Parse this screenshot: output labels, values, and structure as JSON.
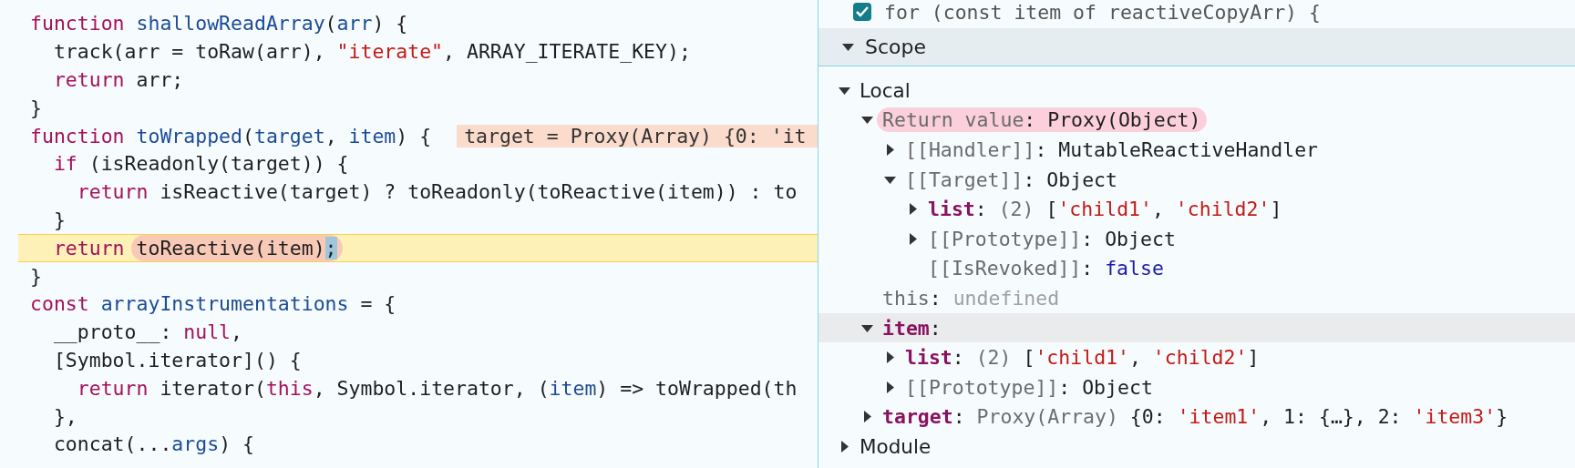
{
  "code": {
    "lines": [
      {
        "current": false,
        "tokens": [
          {
            "kind": "keyword",
            "text": "function "
          },
          {
            "kind": "name",
            "text": "shallowReadArray"
          },
          {
            "kind": "plain",
            "text": "("
          },
          {
            "kind": "name",
            "text": "arr"
          },
          {
            "kind": "plain",
            "text": ") {"
          }
        ]
      },
      {
        "current": false,
        "tokens": [
          {
            "kind": "plain",
            "text": "  track(arr = toRaw(arr), "
          },
          {
            "kind": "string",
            "text": "\"iterate\""
          },
          {
            "kind": "plain",
            "text": ", ARRAY_ITERATE_KEY);"
          }
        ]
      },
      {
        "current": false,
        "tokens": [
          {
            "kind": "keyword",
            "text": "  return"
          },
          {
            "kind": "plain",
            "text": " arr;"
          }
        ]
      },
      {
        "current": false,
        "tokens": [
          {
            "kind": "plain",
            "text": "}"
          }
        ]
      },
      {
        "current": false,
        "inline_value": "target = Proxy(Array) {0: 'it",
        "tokens": [
          {
            "kind": "keyword",
            "text": "function "
          },
          {
            "kind": "name",
            "text": "toWrapped"
          },
          {
            "kind": "plain",
            "text": "("
          },
          {
            "kind": "name",
            "text": "target"
          },
          {
            "kind": "plain",
            "text": ", "
          },
          {
            "kind": "name",
            "text": "item"
          },
          {
            "kind": "plain",
            "text": ") {"
          }
        ]
      },
      {
        "current": false,
        "tokens": [
          {
            "kind": "keyword",
            "text": "  if"
          },
          {
            "kind": "plain",
            "text": " (isReadonly(target)) {"
          }
        ]
      },
      {
        "current": false,
        "tokens": [
          {
            "kind": "keyword",
            "text": "    return"
          },
          {
            "kind": "plain",
            "text": " isReactive(target) ? toReadonly(toReactive(item)) : to"
          }
        ]
      },
      {
        "current": false,
        "tokens": [
          {
            "kind": "plain",
            "text": "  }"
          }
        ]
      },
      {
        "current": true,
        "tokens": [
          {
            "kind": "keyword",
            "text": "  return "
          },
          {
            "kind": "circled",
            "tokens": [
              {
                "kind": "plain",
                "text": "toReactive(item)"
              },
              {
                "kind": "selection",
                "text": ";"
              }
            ]
          }
        ]
      },
      {
        "current": false,
        "tokens": [
          {
            "kind": "plain",
            "text": "}"
          }
        ]
      },
      {
        "current": false,
        "tokens": [
          {
            "kind": "keyword",
            "text": "const "
          },
          {
            "kind": "name",
            "text": "arrayInstrumentations"
          },
          {
            "kind": "plain",
            "text": " = {"
          }
        ]
      },
      {
        "current": false,
        "tokens": [
          {
            "kind": "plain",
            "text": "  __proto__: "
          },
          {
            "kind": "keyword",
            "text": "null"
          },
          {
            "kind": "plain",
            "text": ","
          }
        ]
      },
      {
        "current": false,
        "tokens": [
          {
            "kind": "plain",
            "text": "  [Symbol.iterator]() {"
          }
        ]
      },
      {
        "current": false,
        "tokens": [
          {
            "kind": "keyword",
            "text": "    return"
          },
          {
            "kind": "plain",
            "text": " iterator("
          },
          {
            "kind": "keyword",
            "text": "this"
          },
          {
            "kind": "plain",
            "text": ", Symbol.iterator, ("
          },
          {
            "kind": "name",
            "text": "item"
          },
          {
            "kind": "plain",
            "text": ") => toWrapped(th"
          }
        ]
      },
      {
        "current": false,
        "tokens": [
          {
            "kind": "plain",
            "text": "  },"
          }
        ]
      },
      {
        "current": false,
        "tokens": [
          {
            "kind": "plain",
            "text": "  concat(..."
          },
          {
            "kind": "name",
            "text": "args"
          },
          {
            "kind": "plain",
            "text": ") {"
          }
        ]
      }
    ]
  },
  "breakpoint": {
    "checked": true,
    "code": "for (const item of reactiveCopyArr) {"
  },
  "scope": {
    "title": "Scope",
    "expanded": true,
    "tree": [
      {
        "key": "Local",
        "kind": "name",
        "expanded": true,
        "selected": false,
        "highlighted": false,
        "children": [
          {
            "key": "Return value",
            "kind": "internal",
            "expanded": true,
            "selected": false,
            "highlighted": true,
            "value": [
              {
                "kind": "plain",
                "text": ": Proxy(Object)"
              }
            ],
            "children": [
              {
                "key": "[[Handler]]",
                "kind": "internal",
                "expanded": false,
                "selected": false,
                "highlighted": false,
                "value": [
                  {
                    "kind": "plain",
                    "text": ": MutableReactiveHandler"
                  }
                ]
              },
              {
                "key": "[[Target]]",
                "kind": "internal",
                "expanded": true,
                "selected": false,
                "highlighted": false,
                "value": [
                  {
                    "kind": "plain",
                    "text": ": Object"
                  }
                ],
                "children": [
                  {
                    "key": "list",
                    "kind": "property",
                    "expanded": false,
                    "selected": false,
                    "highlighted": false,
                    "value": [
                      {
                        "kind": "plain",
                        "text": ": "
                      },
                      {
                        "kind": "muted",
                        "text": "(2) "
                      },
                      {
                        "kind": "plain",
                        "text": "["
                      },
                      {
                        "kind": "string",
                        "text": "'child1'"
                      },
                      {
                        "kind": "plain",
                        "text": ", "
                      },
                      {
                        "kind": "string",
                        "text": "'child2'"
                      },
                      {
                        "kind": "plain",
                        "text": "]"
                      }
                    ]
                  },
                  {
                    "key": "[[Prototype]]",
                    "kind": "internal",
                    "expanded": false,
                    "selected": false,
                    "highlighted": false,
                    "value": [
                      {
                        "kind": "plain",
                        "text": ": Object"
                      }
                    ]
                  },
                  {
                    "key": "[[IsRevoked]]",
                    "kind": "internal",
                    "selected": false,
                    "highlighted": false,
                    "value": [
                      {
                        "kind": "plain",
                        "text": ": "
                      },
                      {
                        "kind": "literal",
                        "text": "false"
                      }
                    ]
                  }
                ]
              }
            ]
          },
          {
            "key": "this",
            "kind": "internal",
            "selected": false,
            "highlighted": false,
            "value": [
              {
                "kind": "plain",
                "text": ": "
              },
              {
                "kind": "faint",
                "text": "undefined"
              }
            ]
          },
          {
            "key": "item",
            "kind": "property",
            "expanded": true,
            "selected": true,
            "highlighted": false,
            "value": [
              {
                "kind": "plain",
                "text": ":"
              }
            ],
            "children": [
              {
                "key": "list",
                "kind": "property",
                "expanded": false,
                "selected": false,
                "highlighted": false,
                "value": [
                  {
                    "kind": "plain",
                    "text": ": "
                  },
                  {
                    "kind": "muted",
                    "text": "(2) "
                  },
                  {
                    "kind": "plain",
                    "text": "["
                  },
                  {
                    "kind": "string",
                    "text": "'child1'"
                  },
                  {
                    "kind": "plain",
                    "text": ", "
                  },
                  {
                    "kind": "string",
                    "text": "'child2'"
                  },
                  {
                    "kind": "plain",
                    "text": "]"
                  }
                ]
              },
              {
                "key": "[[Prototype]]",
                "kind": "internal",
                "expanded": false,
                "selected": false,
                "highlighted": false,
                "value": [
                  {
                    "kind": "plain",
                    "text": ": Object"
                  }
                ]
              }
            ]
          },
          {
            "key": "target",
            "kind": "property",
            "expanded": false,
            "selected": false,
            "highlighted": false,
            "value": [
              {
                "kind": "plain",
                "text": ": "
              },
              {
                "kind": "muted",
                "text": "Proxy(Array) "
              },
              {
                "kind": "plain",
                "text": "{0: "
              },
              {
                "kind": "string",
                "text": "'item1'"
              },
              {
                "kind": "plain",
                "text": ", 1: {…}, 2: "
              },
              {
                "kind": "string",
                "text": "'item3'"
              },
              {
                "kind": "plain",
                "text": "}"
              }
            ]
          }
        ]
      },
      {
        "key": "Module",
        "kind": "name",
        "expanded": false,
        "selected": false,
        "highlighted": false
      }
    ]
  }
}
